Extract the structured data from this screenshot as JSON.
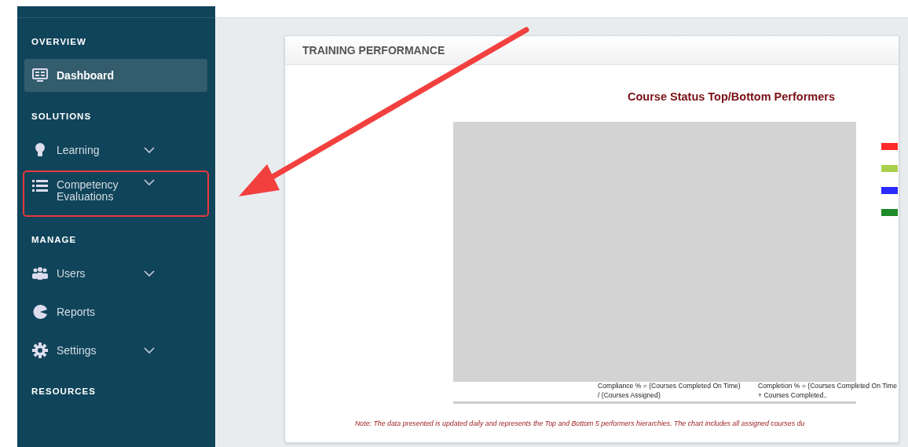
{
  "sidebar": {
    "sections": [
      {
        "title": "OVERVIEW",
        "items": [
          {
            "kind": "monitor",
            "label": "Dashboard",
            "selected": true,
            "expandable": false,
            "outlined": false
          }
        ]
      },
      {
        "title": "SOLUTIONS",
        "items": [
          {
            "kind": "bulb",
            "label": "Learning",
            "selected": false,
            "expandable": true,
            "outlined": false
          },
          {
            "kind": "list",
            "label": "Competency Evaluations",
            "selected": false,
            "expandable": true,
            "outlined": true
          }
        ]
      },
      {
        "title": "MANAGE",
        "items": [
          {
            "kind": "users",
            "label": "Users",
            "selected": false,
            "expandable": true,
            "outlined": false
          },
          {
            "kind": "pie",
            "label": "Reports",
            "selected": false,
            "expandable": false,
            "outlined": false
          },
          {
            "kind": "gear",
            "label": "Settings",
            "selected": false,
            "expandable": true,
            "outlined": false
          }
        ]
      },
      {
        "title": "RESOURCES"
      }
    ]
  },
  "panel": {
    "title": "TRAINING PERFORMANCE",
    "chart": {
      "title": "Course Status Top/Bottom Performers",
      "legend": [
        {
          "color": "#ff2a2a"
        },
        {
          "color": "#a8d04a"
        },
        {
          "color": "#2a2aff"
        },
        {
          "color": "#1e8a2a"
        }
      ],
      "formulas": [
        "Compliance % = (Courses Completed On Time) / (Courses Assigned)",
        "Completion % = (Courses Completed On Time + Courses Completed.."
      ]
    },
    "note": "Note: The data presented is updated daily and represents the Top and Bottom 5 performers hierarchies. The chart includes all assigned courses du"
  },
  "callout_arrow": true
}
